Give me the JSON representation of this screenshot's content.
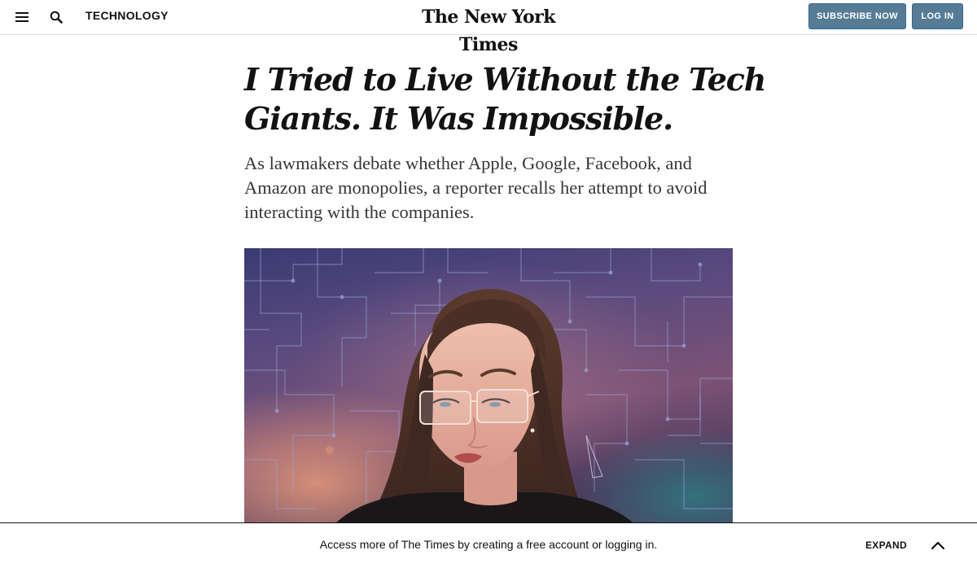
{
  "header": {
    "menu_icon": "hamburger-menu-icon",
    "search_icon": "search-icon",
    "section": "TECHNOLOGY",
    "masthead": "The New York Times",
    "subscribe_label": "SUBSCRIBE NOW",
    "login_label": "LOG IN",
    "button_color": "#567b95"
  },
  "article": {
    "headline": "I Tried to Live Without the Tech Giants. It Was Impossible.",
    "summary": "As lawmakers debate whether Apple, Google, Facebook, and Amazon are monopolies, a reporter recalls her attempt to avoid interacting with the companies.",
    "illustration": "woman-with-transparent-glasses-circuit-background-illustration"
  },
  "bottom_bar": {
    "message": "Access more of The Times by creating a free account or logging in.",
    "expand_label": "EXPAND",
    "expand_icon": "chevron-up-icon"
  }
}
